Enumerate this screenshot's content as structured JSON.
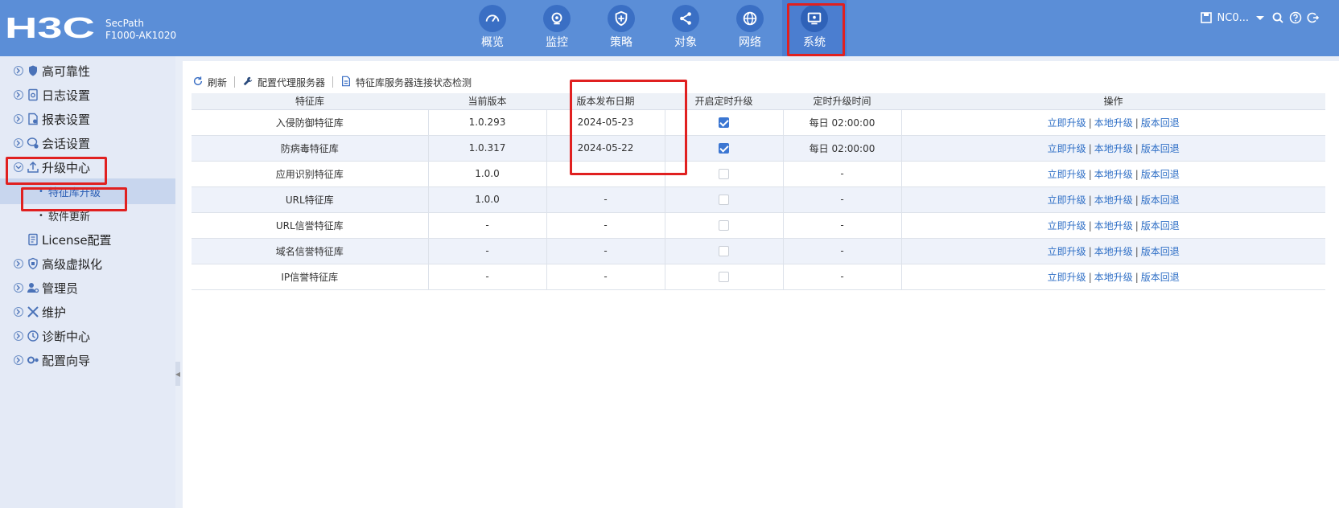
{
  "header": {
    "logo_text": "H3C",
    "product_line1": "SecPath",
    "product_line2": "F1000-AK1020",
    "nav": [
      {
        "label": "概览",
        "icon": "gauge-icon"
      },
      {
        "label": "监控",
        "icon": "camera-icon"
      },
      {
        "label": "策略",
        "icon": "shield-icon"
      },
      {
        "label": "对象",
        "icon": "share-icon"
      },
      {
        "label": "网络",
        "icon": "globe-icon"
      },
      {
        "label": "系统",
        "icon": "monitor-icon",
        "active": true
      }
    ],
    "device_name": "NC0...",
    "colors": {
      "header_bg": "#5b8ed7",
      "active_tab": "#4b7ed0",
      "highlight": "#e02020"
    }
  },
  "sidebar": {
    "items": [
      {
        "label": "高可靠性",
        "icon": "shield-icon"
      },
      {
        "label": "日志设置",
        "icon": "log-icon"
      },
      {
        "label": "报表设置",
        "icon": "report-icon"
      },
      {
        "label": "会话设置",
        "icon": "session-icon"
      },
      {
        "label": "升级中心",
        "icon": "upgrade-icon",
        "expanded": true
      },
      {
        "label": "License配置",
        "icon": "license-icon"
      },
      {
        "label": "高级虚拟化",
        "icon": "virtualization-icon"
      },
      {
        "label": "管理员",
        "icon": "admin-icon"
      },
      {
        "label": "维护",
        "icon": "tools-icon"
      },
      {
        "label": "诊断中心",
        "icon": "diagnosis-icon"
      },
      {
        "label": "配置向导",
        "icon": "wizard-icon"
      }
    ],
    "subitems": [
      {
        "label": "特征库升级",
        "active": true
      },
      {
        "label": "软件更新"
      }
    ]
  },
  "toolbar": {
    "refresh": "刷新",
    "proxy": "配置代理服务器",
    "check": "特征库服务器连接状态检测"
  },
  "table": {
    "headers": [
      "特征库",
      "当前版本",
      "版本发布日期",
      "开启定时升级",
      "定时升级时间",
      "操作"
    ],
    "rows": [
      {
        "name": "入侵防御特征库",
        "version": "1.0.293",
        "date": "2024-05-23",
        "timed": true,
        "time": "每日 02:00:00"
      },
      {
        "name": "防病毒特征库",
        "version": "1.0.317",
        "date": "2024-05-22",
        "timed": true,
        "time": "每日 02:00:00"
      },
      {
        "name": "应用识别特征库",
        "version": "1.0.0",
        "date": "-",
        "timed": false,
        "time": "-"
      },
      {
        "name": "URL特征库",
        "version": "1.0.0",
        "date": "-",
        "timed": false,
        "time": "-"
      },
      {
        "name": "URL信誉特征库",
        "version": "-",
        "date": "-",
        "timed": false,
        "time": "-"
      },
      {
        "name": "域名信誉特征库",
        "version": "-",
        "date": "-",
        "timed": false,
        "time": "-"
      },
      {
        "name": "IP信誉特征库",
        "version": "-",
        "date": "-",
        "timed": false,
        "time": "-"
      }
    ],
    "ops": {
      "upgrade_now": "立即升级",
      "local_upgrade": "本地升级",
      "rollback": "版本回退",
      "separator": "|"
    }
  }
}
